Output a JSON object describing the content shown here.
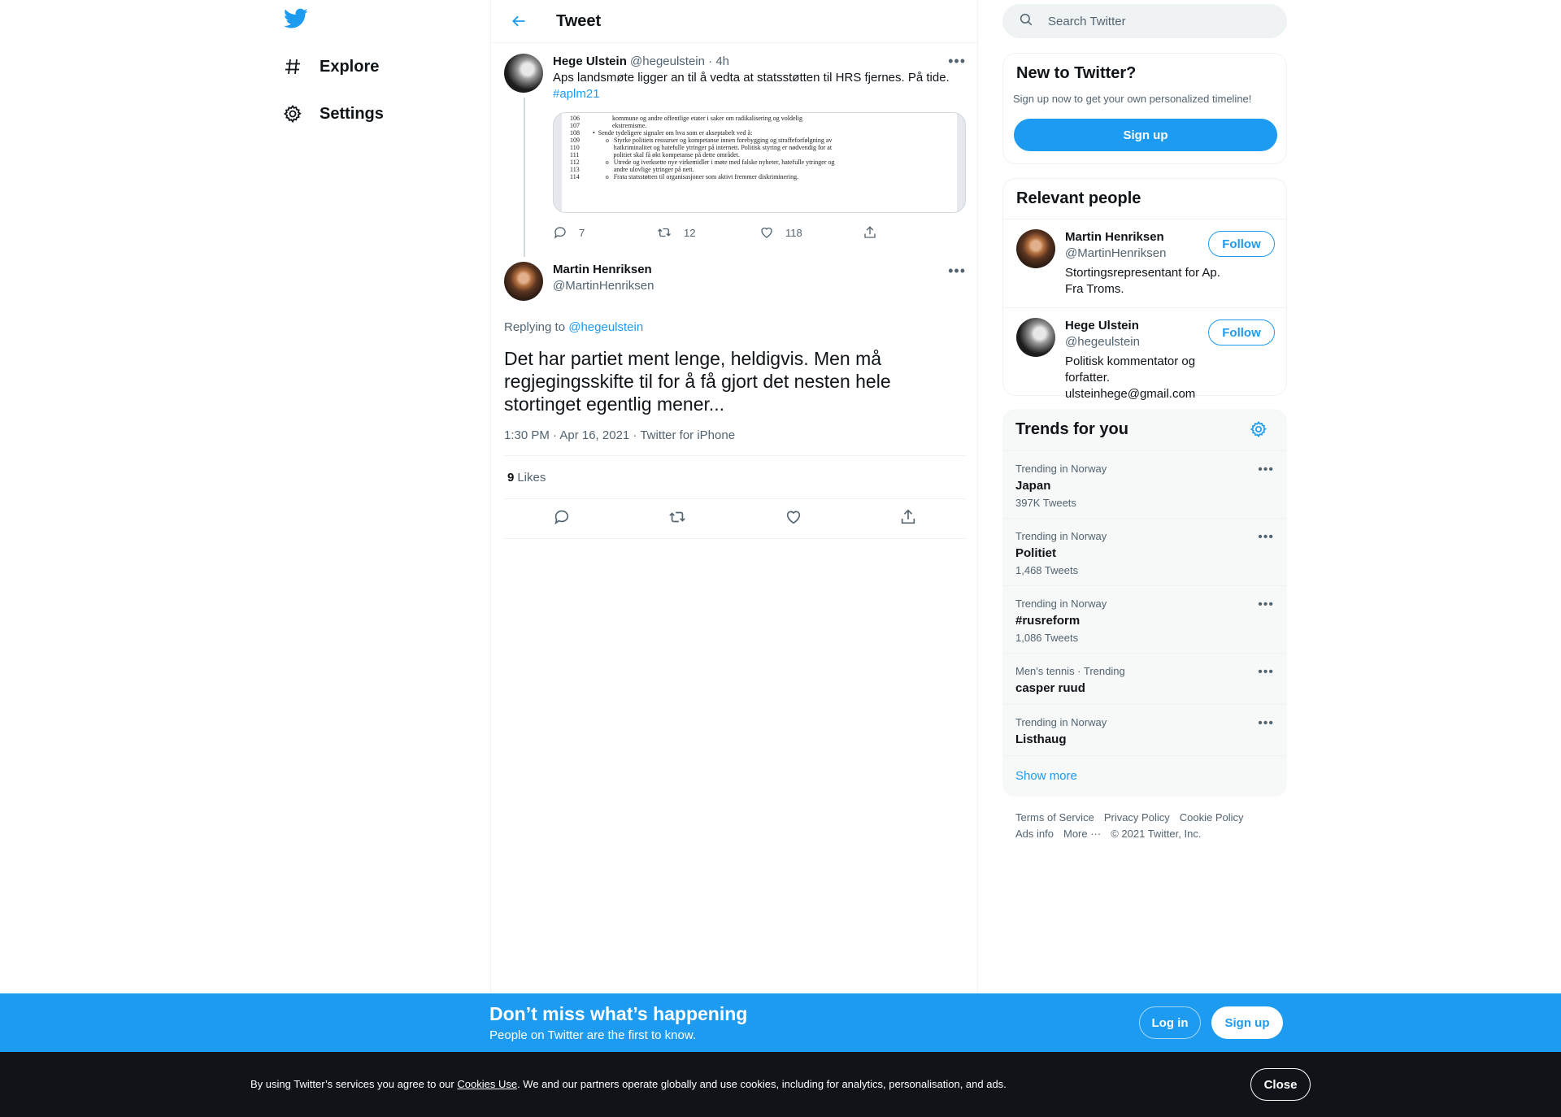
{
  "nav": {
    "logo_icon": "twitter-bird-icon",
    "items": [
      {
        "label": "Explore",
        "icon": "hash-icon"
      },
      {
        "label": "Settings",
        "icon": "gear-icon"
      }
    ]
  },
  "header": {
    "title": "Tweet"
  },
  "parent_tweet": {
    "name": "Hege Ulstein",
    "handle": "@hegeulstein",
    "time": "· 4h",
    "text": "Aps landsmøte ligger an til å vedta at statsstøtten til HRS fjernes. På tide.",
    "hashtag": "#aplm21",
    "media_lines": [
      "106                    kommune og andre offentlige etater i saker om radikalisering og voldelig",
      "107                    ekstremisme.",
      "108        •  Sende tydeligere signaler om hva som er akseptabelt ved å:",
      "109                o   Styrke politiets ressurser og kompetanse innen forebygging og straffeforfølgning av",
      "110                     hatkriminalitet og hatefulle ytringer på internett. Politisk styring er nødvendig for at",
      "111                     politiet skal få økt kompetanse på dette området.",
      "112                o   Utrede og iverksette nye virkemidler i møte med falske nyheter, hatefulle ytringer og",
      "113                     andre ulovlige ytringer på nett.",
      "114                o   Frata statsstøtten til organisasjoner som aktivt fremmer diskriminering."
    ],
    "replies": "7",
    "retweets": "12",
    "likes": "118"
  },
  "reply_tweet": {
    "name": "Martin Henriksen",
    "handle": "@MartinHenriksen",
    "replying_prefix": "Replying to",
    "replying_to": "@hegeulstein",
    "text": "Det har partiet ment lenge, heldigvis. Men må regjegingsskifte til for å få gjort det nesten hele stortinget egentlig mener...",
    "meta": "1:30 PM · Apr 16, 2021 · Twitter for iPhone",
    "likes_count": "9",
    "likes_label": "Likes"
  },
  "search": {
    "placeholder": "Search Twitter"
  },
  "new_to_twitter": {
    "title": "New to Twitter?",
    "subtitle": "Sign up now to get your own personalized timeline!",
    "button": "Sign up"
  },
  "relevant_people": {
    "title": "Relevant people",
    "people": [
      {
        "name": "Martin Henriksen",
        "handle": "@MartinHenriksen",
        "bio": "Stortingsrepresentant for Ap. Fra Troms.",
        "follow": "Follow"
      },
      {
        "name": "Hege Ulstein",
        "handle": "@hegeulstein",
        "bio": "Politisk kommentator og forfatter. ulsteinhege@gmail.com",
        "follow": "Follow"
      }
    ]
  },
  "trends": {
    "title": "Trends for you",
    "items": [
      {
        "context": "Trending in Norway",
        "name": "Japan",
        "count": "397K Tweets"
      },
      {
        "context": "Trending in Norway",
        "name": "Politiet",
        "count": "1,468 Tweets"
      },
      {
        "context": "Trending in Norway",
        "name": "#rusreform",
        "count": "1,086 Tweets"
      },
      {
        "context": "Men's tennis · Trending",
        "name": "casper ruud",
        "count": ""
      },
      {
        "context": "Trending in Norway",
        "name": "Listhaug",
        "count": ""
      }
    ],
    "show_more": "Show more"
  },
  "footer": {
    "links": [
      "Terms of Service",
      "Privacy Policy",
      "Cookie Policy",
      "Ads info",
      "More ···"
    ],
    "copyright": "© 2021 Twitter, Inc."
  },
  "banner": {
    "heading": "Don’t miss what’s happening",
    "subheading": "People on Twitter are the first to know.",
    "login": "Log in",
    "signup": "Sign up"
  },
  "cookie": {
    "prefix": "By using Twitter’s services you agree to our",
    "link": "Cookies Use",
    "suffix": ". We and our partners operate globally and use cookies, including for analytics, personalisation, and ads.",
    "close": "Close"
  },
  "colors": {
    "accent": "#1d9bf0",
    "text": "#0f1419",
    "muted": "#536471",
    "cookie_bg": "#101318"
  }
}
